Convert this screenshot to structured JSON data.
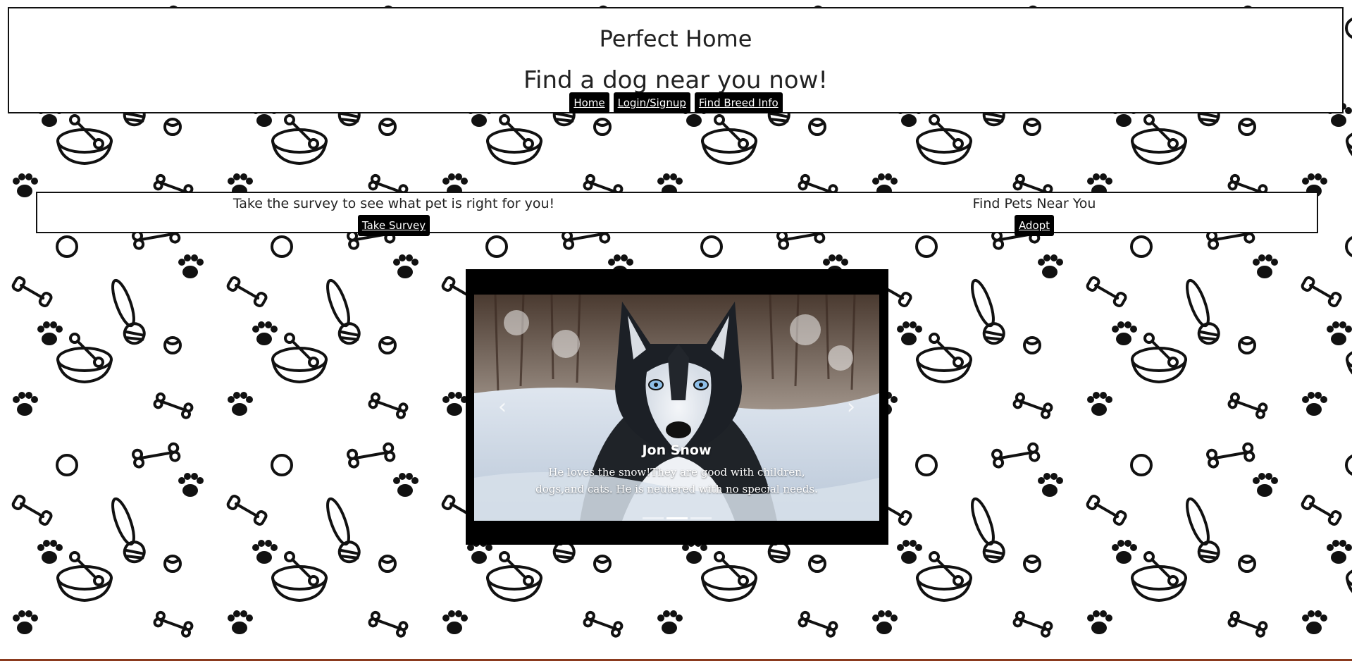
{
  "header": {
    "title": "Perfect Home",
    "tagline": "Find a dog near you now!"
  },
  "nav": {
    "items": [
      "Home",
      "Login/Signup",
      "Find Breed Info"
    ]
  },
  "survey_panel": {
    "survey_text": "Take the survey to see what pet is right for you!",
    "survey_button": "Take Survey",
    "adopt_text": "Find Pets Near You",
    "adopt_button": "Adopt"
  },
  "carousel": {
    "slide_title": "Jon Snow",
    "slide_text_line1": "He loves the snow!They are good with children,",
    "slide_text_line2": "dogs,and cats. He is neutered with no special needs.",
    "prev_icon": "chevron-left-icon",
    "next_icon": "chevron-right-icon"
  },
  "colors": {
    "page_background": "#ffffff",
    "pattern": "#111111",
    "button_bg": "#000000",
    "button_text": "#ffffff",
    "carousel_frame": "#000000"
  }
}
